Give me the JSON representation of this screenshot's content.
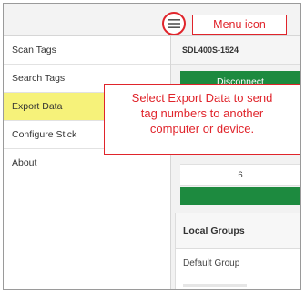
{
  "sidebar": {
    "items": [
      {
        "label": "Scan Tags"
      },
      {
        "label": "Search Tags"
      },
      {
        "label": "Export Data"
      },
      {
        "label": "Configure Stick"
      },
      {
        "label": "About"
      }
    ],
    "active_index": 2
  },
  "main": {
    "device_name": "SDL400S-1524",
    "disconnect_label": "Disconnect",
    "count_value": "6",
    "groups_header": "Local Groups",
    "groups": [
      {
        "label": "Default Group"
      }
    ]
  },
  "callouts": {
    "menu_icon_label": "Menu icon",
    "export_line1": "Select Export Data to send",
    "export_line2": "tag numbers to another",
    "export_line3": "computer or device."
  },
  "colors": {
    "accent_red": "#e0242b",
    "connect_green": "#1d8a3f",
    "highlight_yellow": "#f6f27a"
  },
  "icons": {
    "menu": "hamburger-menu-icon"
  }
}
